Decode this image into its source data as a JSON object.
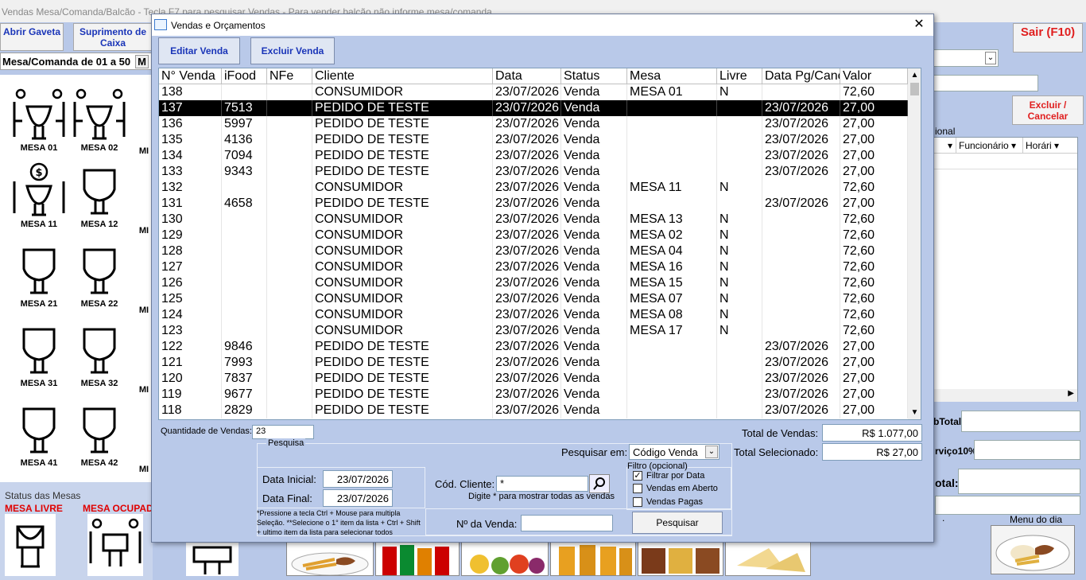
{
  "app": {
    "title": "Vendas Mesa/Comanda/Balcão - Tecla F7 para pesquisar Vendas - Para vender balcão não informe mesa/comanda",
    "btn_abrir_gaveta": "Abrir Gaveta",
    "btn_suprimento": "Suprimento de Caixa",
    "range_label": "Mesa/Comanda de 01 a 50",
    "tab_m": "M",
    "btn_sair": "Sair (F10)",
    "btn_excluir": "Excluir / Cancelar",
    "opcional_label": "ional",
    "col_funcionario": "Funcionário",
    "col_horario": "Horári",
    "subtotal_label": "bTotal:",
    "servico_label": "rviço10%:",
    "total_label": "otal:",
    "menu_dia": "Menu do dia",
    "dot": "."
  },
  "mesas": [
    {
      "label": "MESA 01",
      "type": "occupied"
    },
    {
      "label": "MESA 02",
      "type": "occupied"
    },
    {
      "label": "MESA 11",
      "type": "pay"
    },
    {
      "label": "MESA 12",
      "type": "free"
    },
    {
      "label": "MESA 21",
      "type": "free"
    },
    {
      "label": "MESA 22",
      "type": "free"
    },
    {
      "label": "MESA 31",
      "type": "free"
    },
    {
      "label": "MESA 32",
      "type": "free"
    },
    {
      "label": "MESA 41",
      "type": "free"
    },
    {
      "label": "MESA 42",
      "type": "free"
    }
  ],
  "mesa_partial": "MI",
  "status": {
    "title": "Status das Mesas",
    "livre": "MESA LIVRE",
    "ocupada": "MESA OCUPADA"
  },
  "dialog": {
    "title": "Vendas e Orçamentos",
    "editar": "Editar Venda",
    "excluir": "Excluir Venda",
    "columns": [
      "N° Venda",
      "iFood",
      "NFe",
      "Cliente",
      "Data",
      "Status",
      "Mesa",
      "Livre",
      "Data Pg/Canc",
      "Valor"
    ],
    "rows": [
      [
        "138",
        "",
        "",
        "CONSUMIDOR",
        "23/07/2026",
        "Venda",
        "MESA 01",
        "N",
        "",
        "72,60"
      ],
      [
        "137",
        "7513",
        "",
        "PEDIDO DE TESTE",
        "23/07/2026",
        "Venda",
        "",
        "",
        "23/07/2026",
        "27,00"
      ],
      [
        "136",
        "5997",
        "",
        "PEDIDO DE TESTE",
        "23/07/2026",
        "Venda",
        "",
        "",
        "23/07/2026",
        "27,00"
      ],
      [
        "135",
        "4136",
        "",
        "PEDIDO DE TESTE",
        "23/07/2026",
        "Venda",
        "",
        "",
        "23/07/2026",
        "27,00"
      ],
      [
        "134",
        "7094",
        "",
        "PEDIDO DE TESTE",
        "23/07/2026",
        "Venda",
        "",
        "",
        "23/07/2026",
        "27,00"
      ],
      [
        "133",
        "9343",
        "",
        "PEDIDO DE TESTE",
        "23/07/2026",
        "Venda",
        "",
        "",
        "23/07/2026",
        "27,00"
      ],
      [
        "132",
        "",
        "",
        "CONSUMIDOR",
        "23/07/2026",
        "Venda",
        "MESA 11",
        "N",
        "",
        "72,60"
      ],
      [
        "131",
        "4658",
        "",
        "PEDIDO DE TESTE",
        "23/07/2026",
        "Venda",
        "",
        "",
        "23/07/2026",
        "27,00"
      ],
      [
        "130",
        "",
        "",
        "CONSUMIDOR",
        "23/07/2026",
        "Venda",
        "MESA 13",
        "N",
        "",
        "72,60"
      ],
      [
        "129",
        "",
        "",
        "CONSUMIDOR",
        "23/07/2026",
        "Venda",
        "MESA 02",
        "N",
        "",
        "72,60"
      ],
      [
        "128",
        "",
        "",
        "CONSUMIDOR",
        "23/07/2026",
        "Venda",
        "MESA 04",
        "N",
        "",
        "72,60"
      ],
      [
        "127",
        "",
        "",
        "CONSUMIDOR",
        "23/07/2026",
        "Venda",
        "MESA 16",
        "N",
        "",
        "72,60"
      ],
      [
        "126",
        "",
        "",
        "CONSUMIDOR",
        "23/07/2026",
        "Venda",
        "MESA 15",
        "N",
        "",
        "72,60"
      ],
      [
        "125",
        "",
        "",
        "CONSUMIDOR",
        "23/07/2026",
        "Venda",
        "MESA 07",
        "N",
        "",
        "72,60"
      ],
      [
        "124",
        "",
        "",
        "CONSUMIDOR",
        "23/07/2026",
        "Venda",
        "MESA 08",
        "N",
        "",
        "72,60"
      ],
      [
        "123",
        "",
        "",
        "CONSUMIDOR",
        "23/07/2026",
        "Venda",
        "MESA 17",
        "N",
        "",
        "72,60"
      ],
      [
        "122",
        "9846",
        "",
        "PEDIDO DE TESTE",
        "23/07/2026",
        "Venda",
        "",
        "",
        "23/07/2026",
        "27,00"
      ],
      [
        "121",
        "7993",
        "",
        "PEDIDO DE TESTE",
        "23/07/2026",
        "Venda",
        "",
        "",
        "23/07/2026",
        "27,00"
      ],
      [
        "120",
        "7837",
        "",
        "PEDIDO DE TESTE",
        "23/07/2026",
        "Venda",
        "",
        "",
        "23/07/2026",
        "27,00"
      ],
      [
        "119",
        "9677",
        "",
        "PEDIDO DE TESTE",
        "23/07/2026",
        "Venda",
        "",
        "",
        "23/07/2026",
        "27,00"
      ],
      [
        "118",
        "2829",
        "",
        "PEDIDO DE TESTE",
        "23/07/2026",
        "Venda",
        "",
        "",
        "23/07/2026",
        "27,00"
      ]
    ],
    "selected_row": 1,
    "qtd_label": "Quantidade de Vendas:",
    "qtd_value": "23",
    "total_vendas_label": "Total de Vendas:",
    "total_vendas_value": "R$ 1.077,00",
    "total_sel_label": "Total Selecionado:",
    "total_sel_value": "R$ 27,00",
    "pesquisa_group": "Pesquisa",
    "pesquisar_em_label": "Pesquisar em:",
    "pesquisar_em_value": "Código Venda",
    "filtro_group": "Filtro (opcional)",
    "filtrar_data": "Filtrar por Data",
    "filtrar_data_checked": true,
    "vendas_aberto": "Vendas em Aberto",
    "vendas_pagas": "Vendas Pagas",
    "data_inicial_label": "Data Inicial:",
    "data_inicial_value": "23/07/2026",
    "data_final_label": "Data Final:",
    "data_final_value": "23/07/2026",
    "cod_cliente_label": "Cód. Cliente:",
    "cod_cliente_value": "*",
    "cod_cliente_hint": "Digite * para mostrar todas as vendas",
    "help_text": "*Pressione a tecla Ctrl + Mouse para multipla Seleção. **Selecione o 1° item da lista + Ctrl + Shift + ultimo item da lista para selecionar todos",
    "nro_venda_label": "Nº da Venda:",
    "nro_venda_value": "",
    "pesquisar_btn": "Pesquisar",
    "close_glyph": "✕"
  }
}
